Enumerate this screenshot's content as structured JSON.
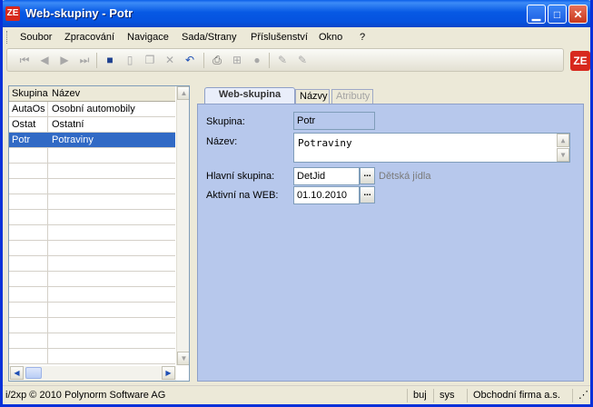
{
  "window": {
    "title": "Web-skupiny - Potr",
    "logo_text": "ZE"
  },
  "menu": {
    "items": [
      "Soubor",
      "Zpracování",
      "Navigace",
      "Sada/Strany",
      "Příslušenství",
      "Okno",
      "?"
    ]
  },
  "toolbar": {
    "icons": [
      "first-record-icon",
      "prev-record-icon",
      "next-record-icon",
      "last-record-icon",
      "save-icon",
      "new-icon",
      "copy-icon",
      "delete-icon",
      "undo-icon",
      "print-icon",
      "tree-icon",
      "search-icon",
      "edit-icon",
      "edit-disabled-icon"
    ]
  },
  "grid": {
    "columns": [
      "Skupina",
      "Název"
    ],
    "rows": [
      {
        "code": "AutaOs",
        "name": "Osobní automobily",
        "selected": false
      },
      {
        "code": "Ostat",
        "name": "Ostatní",
        "selected": false
      },
      {
        "code": "Potr",
        "name": "Potraviny",
        "selected": true
      }
    ]
  },
  "tabs": [
    {
      "label": "Web-skupina",
      "active": true,
      "enabled": true
    },
    {
      "label": "Názvy",
      "active": false,
      "enabled": true
    },
    {
      "label": "Atributy",
      "active": false,
      "enabled": false
    }
  ],
  "form": {
    "skupina_label": "Skupina:",
    "skupina_value": "Potr",
    "nazev_label": "Název:",
    "nazev_value": "Potraviny",
    "hlavni_label": "Hlavní skupina:",
    "hlavni_value": "DetJid",
    "hlavni_hint": "Dětská jídla",
    "aktivni_label": "Aktivní na WEB:",
    "aktivni_value": "01.10.2010",
    "lookup_button": "..."
  },
  "status": {
    "copyright": "i/2xp © 2010 Polynorm Software AG",
    "user": "buj",
    "db": "sys",
    "company": "Obchodní firma a.s."
  },
  "colors": {
    "titlebar": "#0a5ee8",
    "selection": "#316ac5",
    "form_background": "#b7c8ec",
    "brand": "#d7281d"
  }
}
